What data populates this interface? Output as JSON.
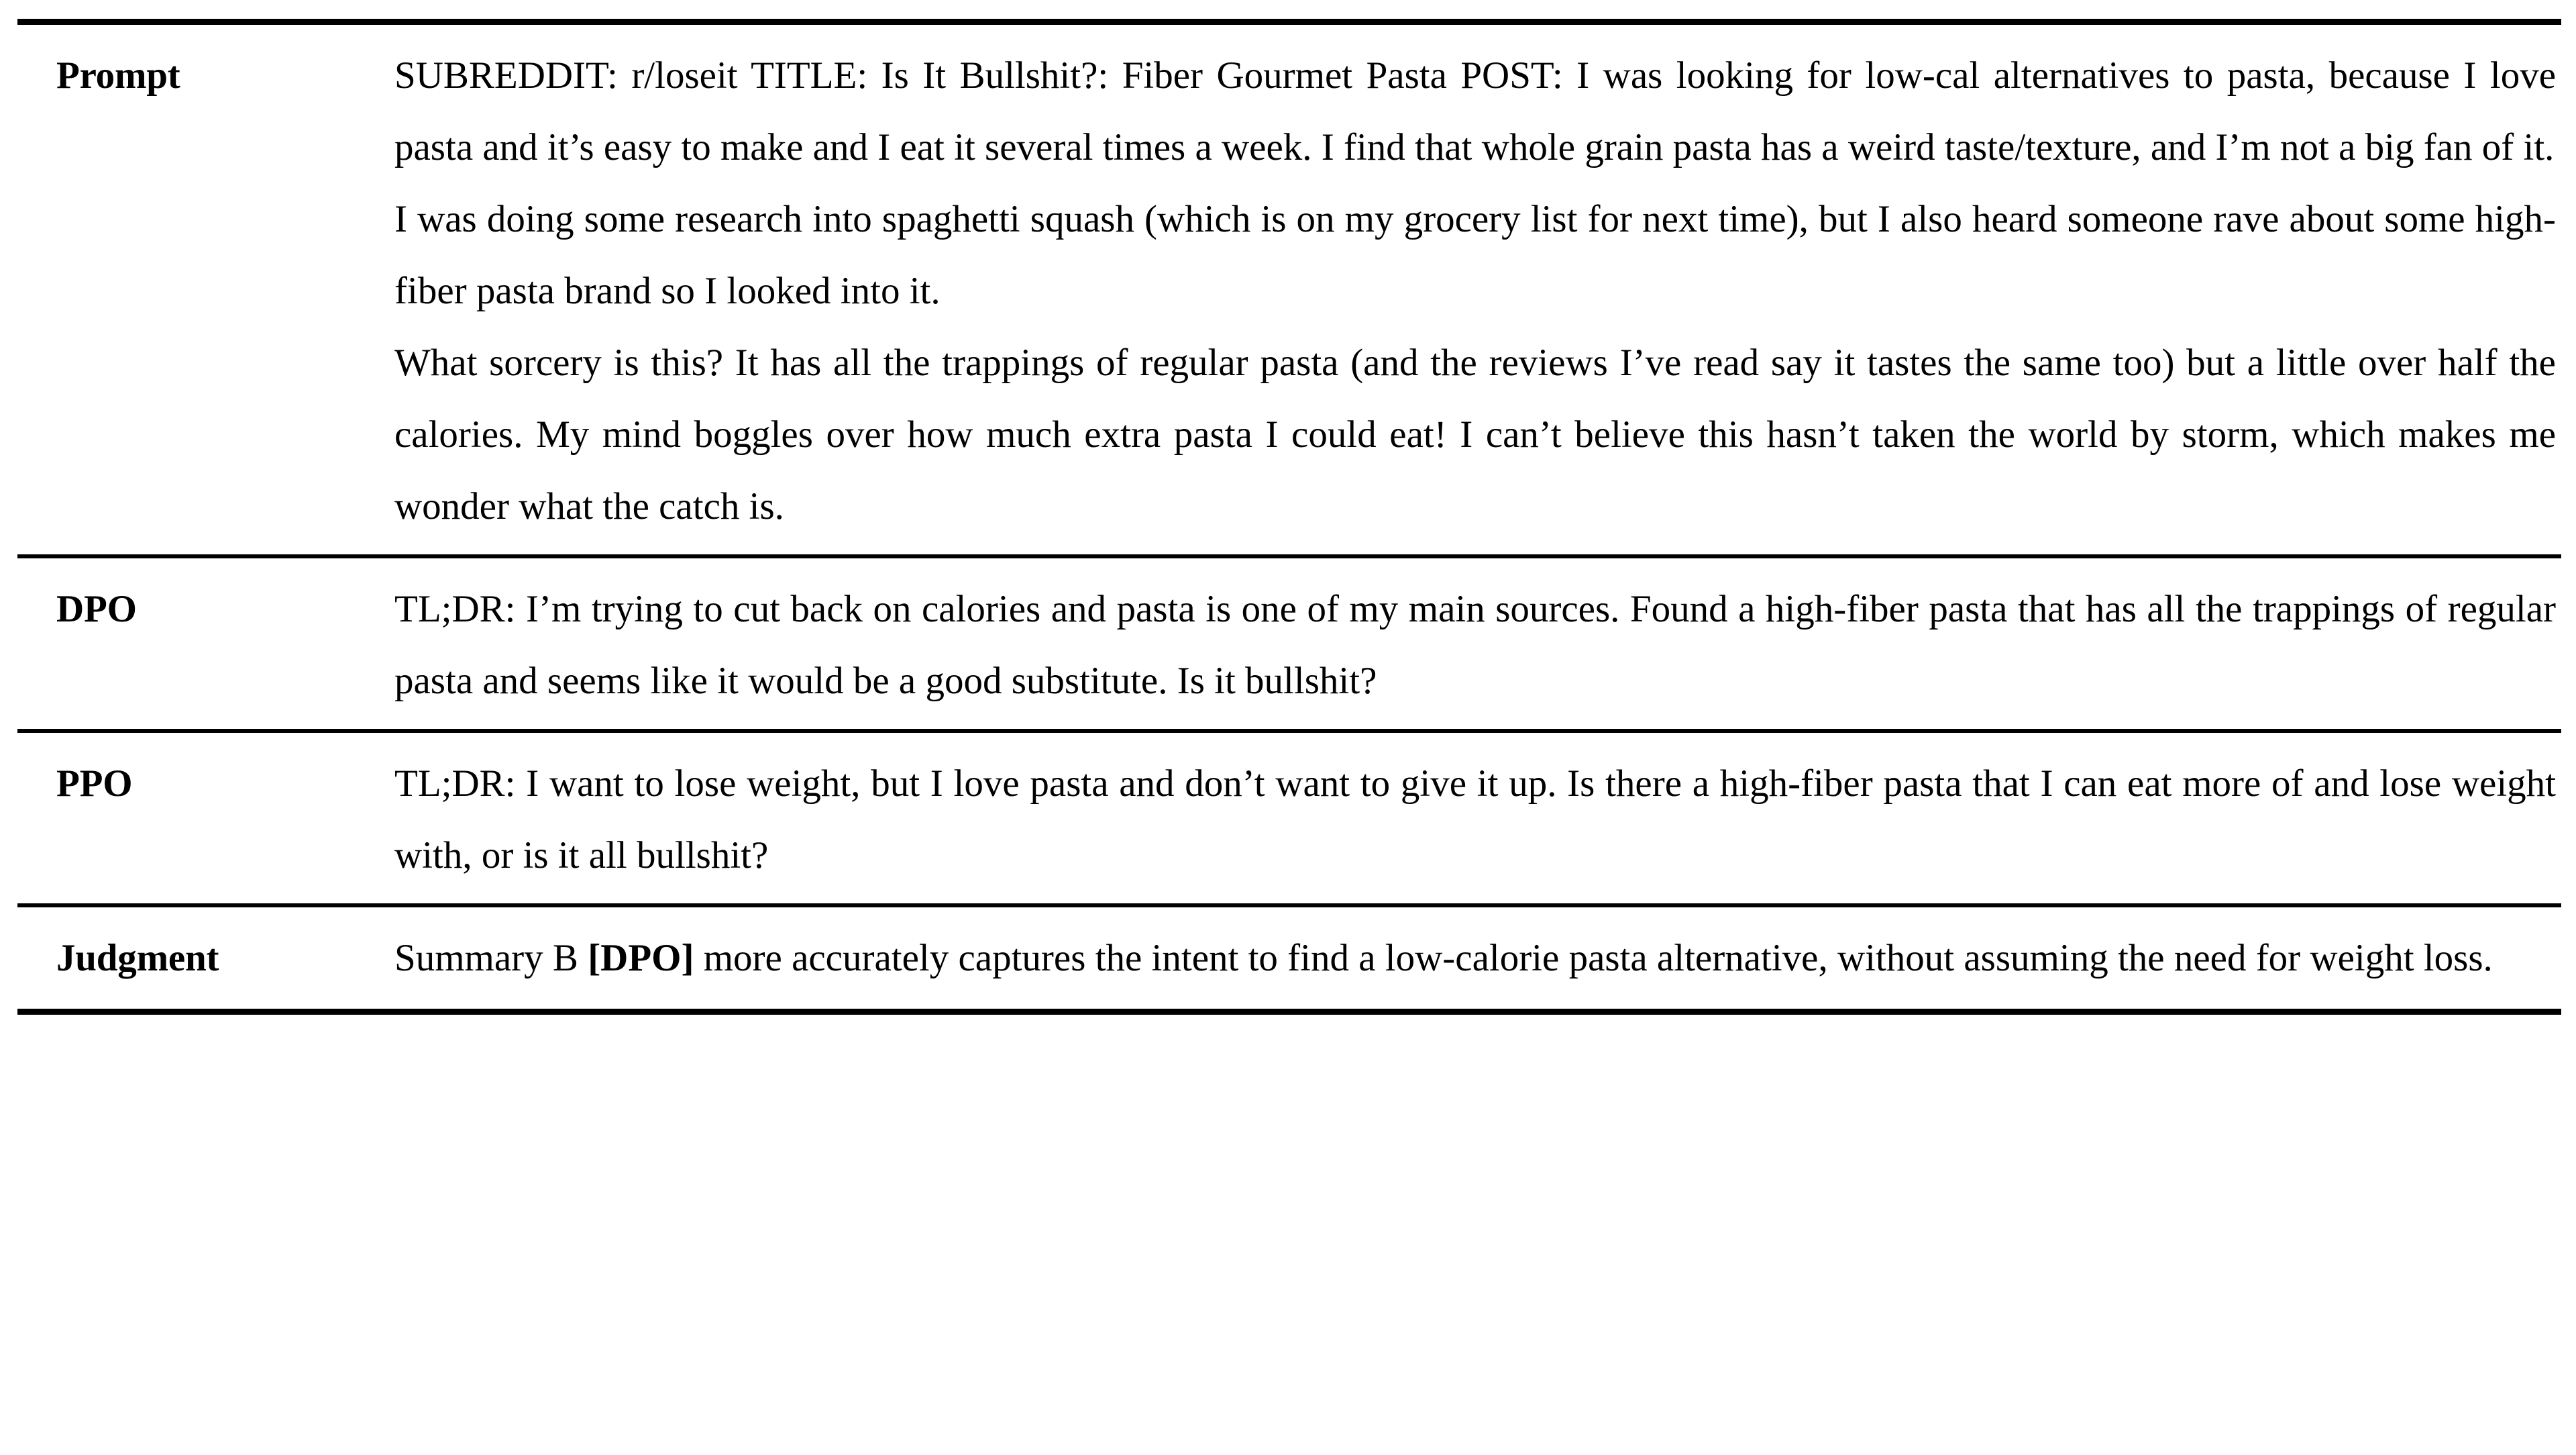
{
  "table": {
    "rows": [
      {
        "id": "prompt",
        "label": "Prompt",
        "paragraphs": [
          "SUBREDDIT: r/loseit TITLE: Is It Bullshit?: Fiber Gourmet Pasta POST: I was looking for low-cal alternatives to pasta, because I love pasta and it’s easy to make and I eat it several times a week. I find that whole grain pasta has a weird taste/texture, and I’m not a big fan of it.",
          "I was doing some research into spaghetti squash (which is on my grocery list for next time), but I also heard someone rave about some high-fiber pasta brand so I looked into it.",
          "What sorcery is this? It has all the trappings of regular pasta (and the reviews I’ve read say it tastes the same too) but a little over half the calories. My mind boggles over how much extra pasta I could eat! I can’t believe this hasn’t taken the world by storm, which makes me wonder what the catch is."
        ]
      },
      {
        "id": "dpo",
        "label": "DPO",
        "paragraphs": [
          "TL;DR: I’m trying to cut back on calories and pasta is one of my main sources. Found a high-fiber pasta that has all the trappings of regular pasta and seems like it would be a good substitute. Is it bullshit?"
        ]
      },
      {
        "id": "ppo",
        "label": "PPO",
        "paragraphs": [
          "TL;DR: I want to lose weight, but I love pasta and don’t want to give it up. Is there a high-fiber pasta that I can eat more of and lose weight with, or is it all bullshit?"
        ]
      },
      {
        "id": "judgment",
        "label": "Judgment",
        "judgment": {
          "prefix": "Summary B ",
          "emphasis": "[DPO]",
          "suffix": " more accurately captures the intent to find a low-calorie pasta alternative, without assuming the need for weight loss."
        }
      }
    ]
  },
  "style": {
    "rule_color": "#000000",
    "text_color": "#000000",
    "background": "#ffffff"
  }
}
